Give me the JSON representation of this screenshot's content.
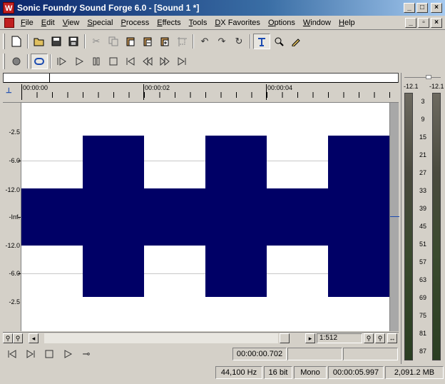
{
  "window": {
    "title": "Sonic Foundry Sound Forge 6.0 - [Sound 1 *]",
    "controls": [
      "_",
      "□",
      "×"
    ]
  },
  "menu": {
    "items": [
      "File",
      "Edit",
      "View",
      "Special",
      "Process",
      "Effects",
      "Tools",
      "DX Favorites",
      "Options",
      "Window",
      "Help"
    ],
    "doc_controls": [
      "_",
      "▫",
      "×"
    ]
  },
  "toolbar1": {
    "buttons": [
      "new-icon",
      "open-icon",
      "save-icon",
      "save-as-icon",
      "cut-icon",
      "copy-icon",
      "paste-icon",
      "paste-mix-icon",
      "paste-new-icon",
      "trim-icon",
      "undo-icon",
      "redo-icon",
      "repeat-icon",
      "edit-tool-icon",
      "magnify-tool-icon",
      "pencil-tool-icon"
    ]
  },
  "toolbar2": {
    "buttons": [
      "record-icon",
      "loop-icon",
      "play-all-icon",
      "play-icon",
      "pause-icon",
      "stop-icon",
      "go-to-start-icon",
      "rewind-icon",
      "forward-icon",
      "go-to-end-icon"
    ]
  },
  "ruler": {
    "labels": [
      "00:00:00",
      "00:00:02",
      "00:00:04"
    ]
  },
  "waveform": {
    "y_labels": [
      "-2.5",
      "-6.0",
      "-12.0",
      "-Inf.",
      "-12.0",
      "-6.0",
      "-2.5"
    ],
    "color": "#000066",
    "background": "#ffffff"
  },
  "scroll": {
    "zoom_ratio": "1:512"
  },
  "transport": {
    "cursor_position": "00:00:00.702",
    "selection_start": "",
    "selection_end": ""
  },
  "status": {
    "sample_rate": "44,100 Hz",
    "bit_depth": "16 bit",
    "channels": "Mono",
    "length": "00:00:05.997",
    "free_space": "2,091.2 MB"
  },
  "meter": {
    "peak_left": "-12.1",
    "peak_right": "-12.1",
    "scale": [
      "3",
      "9",
      "15",
      "21",
      "27",
      "33",
      "39",
      "45",
      "51",
      "57",
      "63",
      "69",
      "75",
      "81",
      "87"
    ]
  }
}
